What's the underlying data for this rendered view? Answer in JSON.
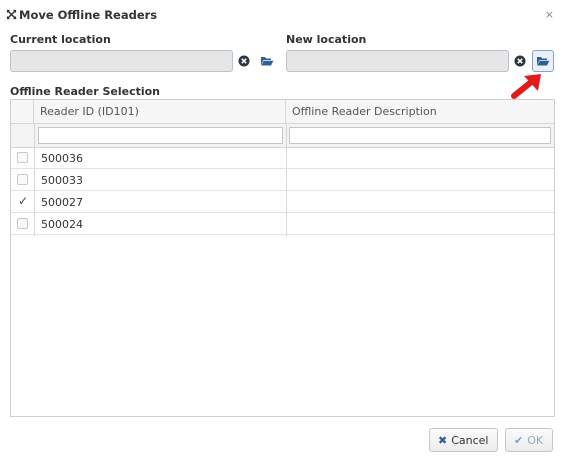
{
  "window": {
    "title": "Move Offline Readers",
    "close_glyph": "×",
    "title_icon": "move-arrows-icon"
  },
  "current_location": {
    "label": "Current location",
    "value": ""
  },
  "new_location": {
    "label": "New location",
    "value": ""
  },
  "selection": {
    "label": "Offline Reader Selection",
    "columns": [
      "Reader ID (ID101)",
      "Offline Reader Description"
    ],
    "filters": [
      "",
      ""
    ],
    "rows": [
      {
        "id": "500036",
        "description": "",
        "checked": false
      },
      {
        "id": "500033",
        "description": "",
        "checked": false
      },
      {
        "id": "500027",
        "description": "",
        "checked": true
      },
      {
        "id": "500024",
        "description": "",
        "checked": false
      }
    ]
  },
  "buttons": {
    "cancel": "Cancel",
    "ok": "OK"
  },
  "colors": {
    "accent_blue": "#2e5f96",
    "annotation_red": "#e11b1b",
    "disabled_text": "#9aa7b6"
  }
}
